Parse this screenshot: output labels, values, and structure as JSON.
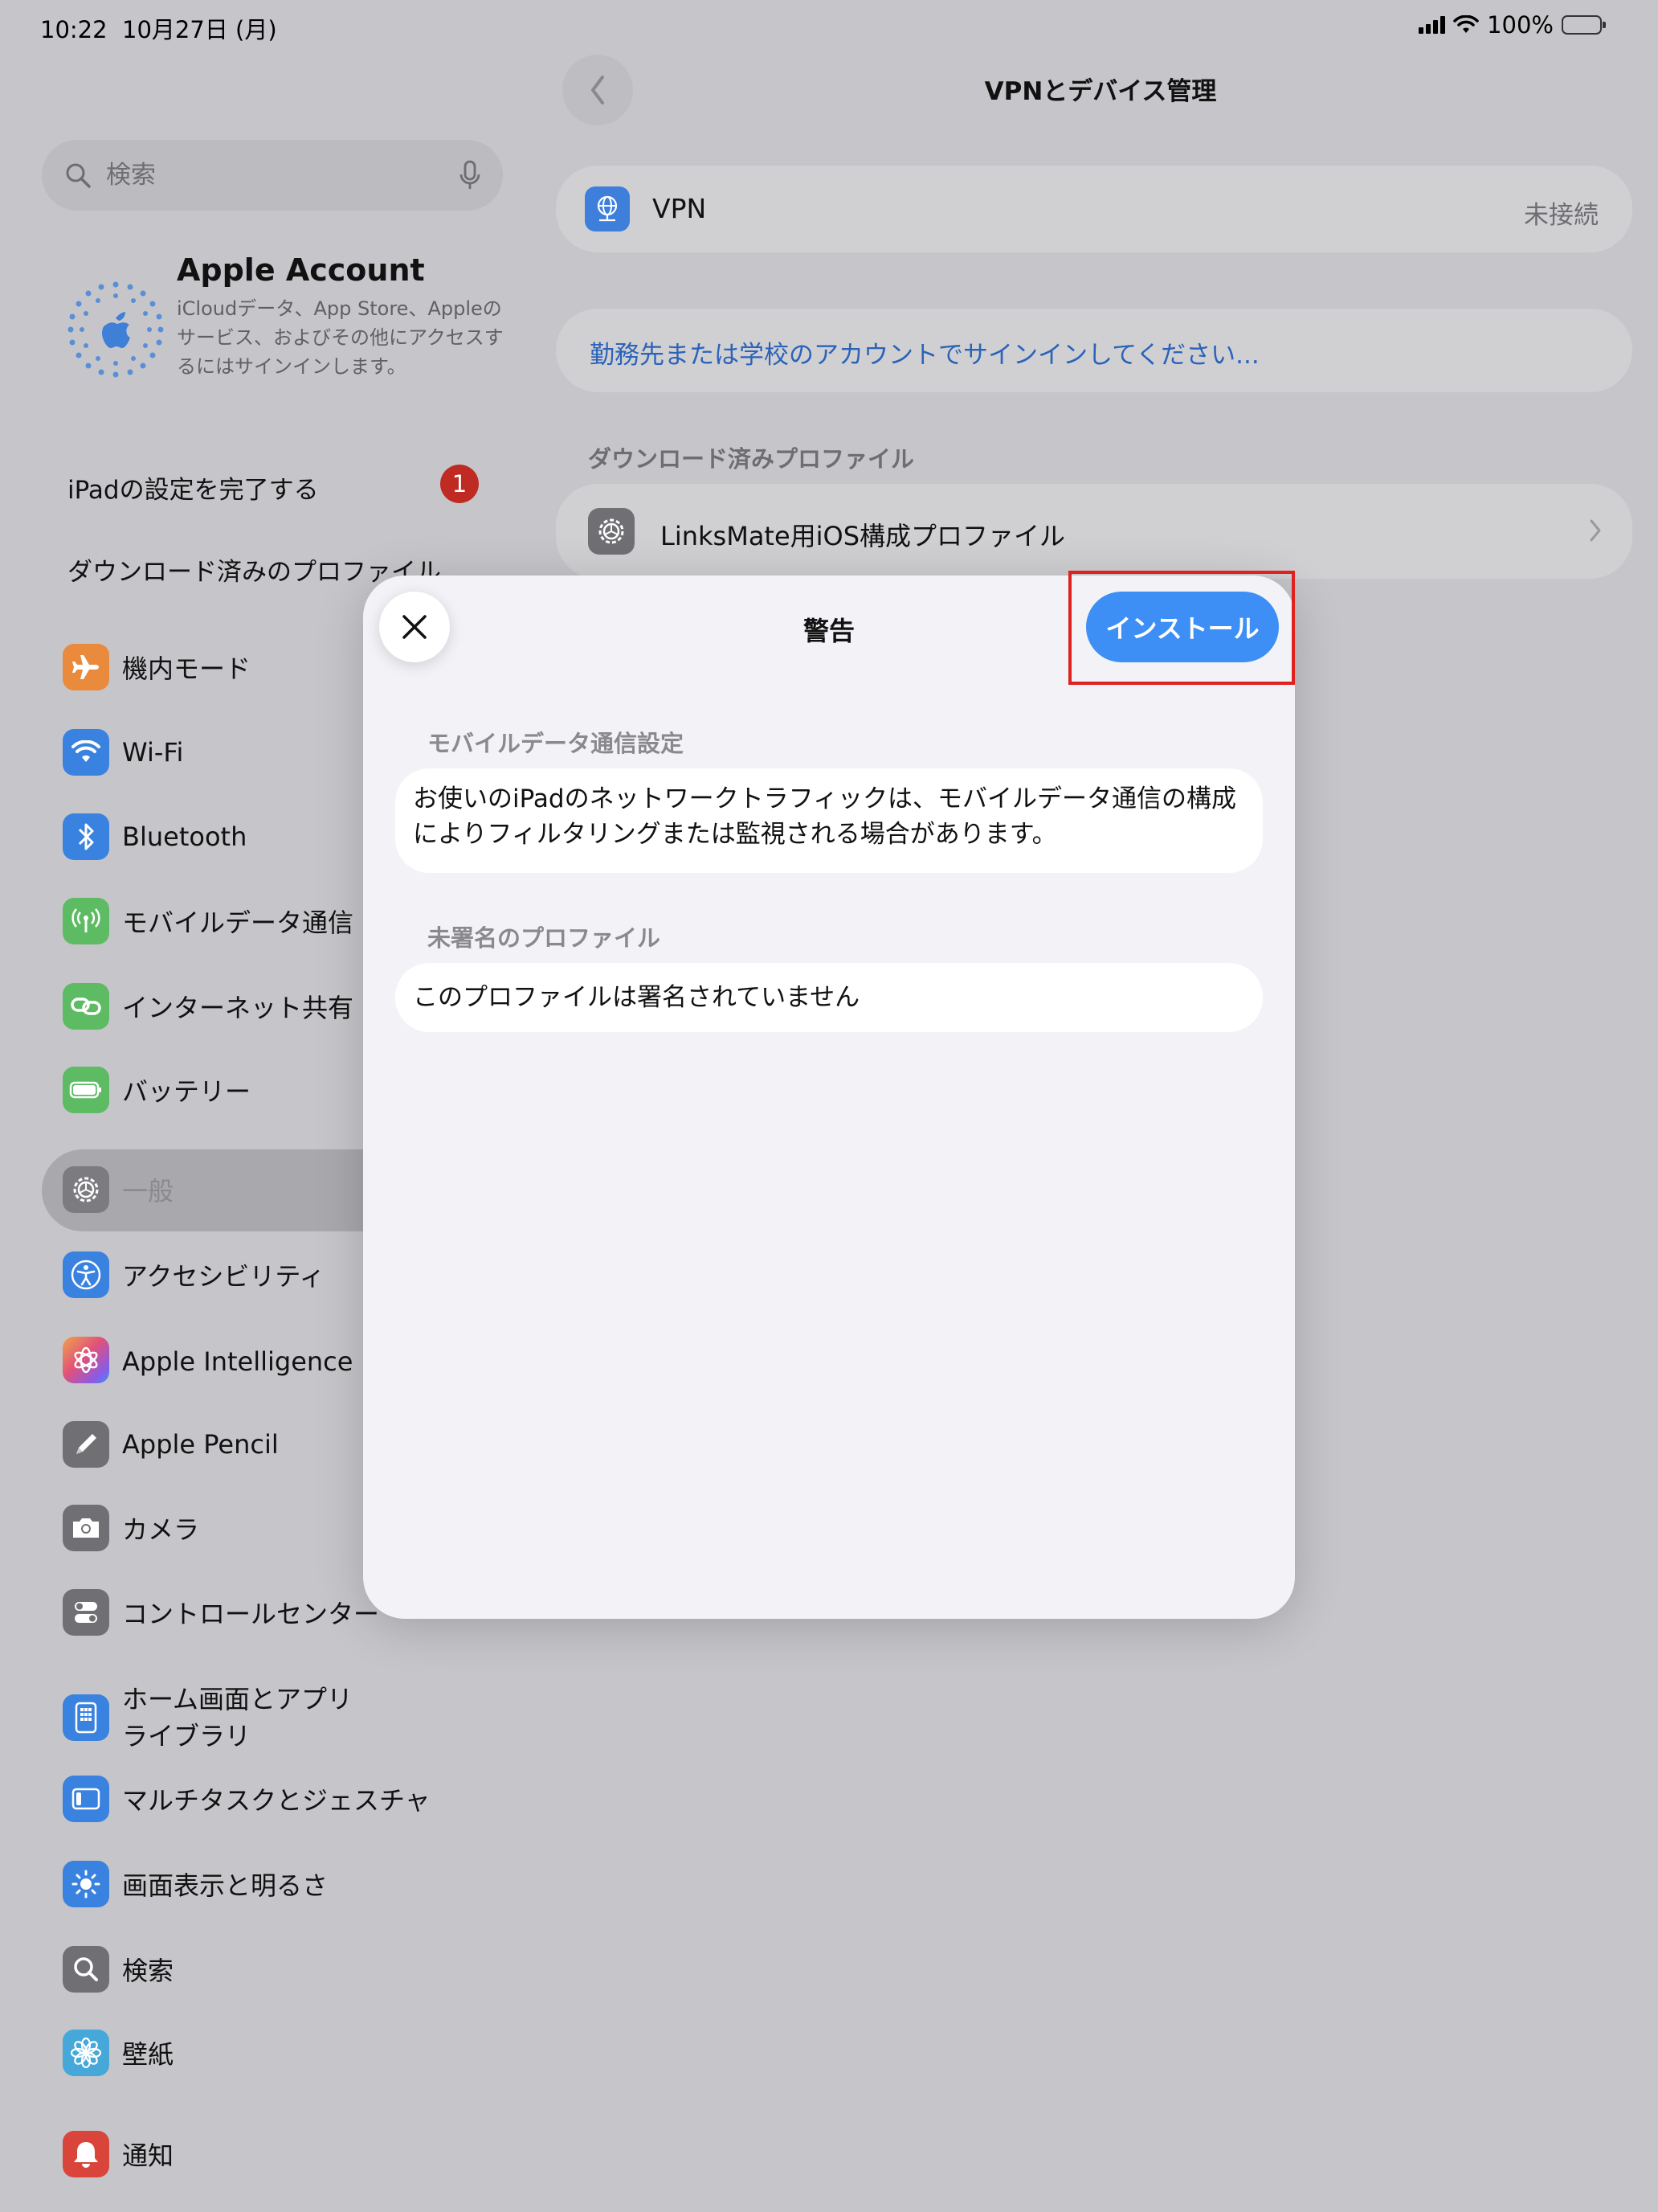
{
  "status_bar": {
    "time": "10:22",
    "date": "10月27日 (月)",
    "battery": "100%"
  },
  "sidebar": {
    "search_placeholder": "検索",
    "account": {
      "title": "Apple Account",
      "description": "iCloudデータ、App Store、Appleのサービス、およびその他にアクセスするにはサインインします。"
    },
    "finish_setup": "iPadの設定を完了する",
    "finish_setup_badge": "1",
    "downloaded_profiles": "ダウンロード済みのプロファイル",
    "items": [
      {
        "label": "機内モード",
        "icon": "airplane-icon",
        "color": "#e98a3c"
      },
      {
        "label": "Wi-Fi",
        "icon": "wifi-icon",
        "color": "#3a82e0"
      },
      {
        "label": "Bluetooth",
        "icon": "bluetooth-icon",
        "color": "#3a82e0"
      },
      {
        "label": "モバイルデータ通信",
        "icon": "antenna-icon",
        "color": "#5dbb63"
      },
      {
        "label": "インターネット共有",
        "icon": "link-icon",
        "color": "#5dbb63"
      },
      {
        "label": "バッテリー",
        "icon": "battery-icon",
        "color": "#5dbb63"
      },
      {
        "label": "一般",
        "icon": "gear-icon",
        "color": "#7c7c80"
      },
      {
        "label": "アクセシビリティ",
        "icon": "accessibility-icon",
        "color": "#3a82e0"
      },
      {
        "label": "Apple Intelligence と",
        "icon": "apple-intelligence-icon",
        "color": "#d9566b"
      },
      {
        "label": "Apple Pencil",
        "icon": "pencil-icon",
        "color": "#707074"
      },
      {
        "label": "カメラ",
        "icon": "camera-icon",
        "color": "#707074"
      },
      {
        "label": "コントロールセンター",
        "icon": "toggle-icon",
        "color": "#707074"
      },
      {
        "label": "ホーム画面とアプリライブラリ",
        "icon": "home-screen-icon",
        "color": "#3a82e0"
      },
      {
        "label": "マルチタスクとジェスチャ",
        "icon": "multitask-icon",
        "color": "#3a82e0"
      },
      {
        "label": "画面表示と明るさ",
        "icon": "sun-icon",
        "color": "#3a82e0"
      },
      {
        "label": "検索",
        "icon": "search-icon",
        "color": "#707074"
      },
      {
        "label": "壁紙",
        "icon": "flower-icon",
        "color": "#45a8d8"
      },
      {
        "label": "通知",
        "icon": "bell-icon",
        "color": "#d9453a"
      }
    ],
    "home_screen_label_line1": "ホーム画面とアプリ",
    "home_screen_label_line2": "ライブラリ"
  },
  "detail": {
    "title": "VPNとデバイス管理",
    "vpn_label": "VPN",
    "vpn_status": "未接続",
    "signin_link": "勤務先または学校のアカウントでサインインしてください...",
    "downloaded_section": "ダウンロード済みプロファイル",
    "profile_name": "LinksMate用iOS構成プロファイル"
  },
  "sheet": {
    "title": "警告",
    "install_label": "インストール",
    "mobile_header": "モバイルデータ通信設定",
    "mobile_text": "お使いのiPadのネットワークトラフィックは、モバイルデータ通信の構成によりフィルタリングまたは監視される場合があります。",
    "unsigned_header": "未署名のプロファイル",
    "unsigned_text": "このプロファイルは署名されていません"
  }
}
